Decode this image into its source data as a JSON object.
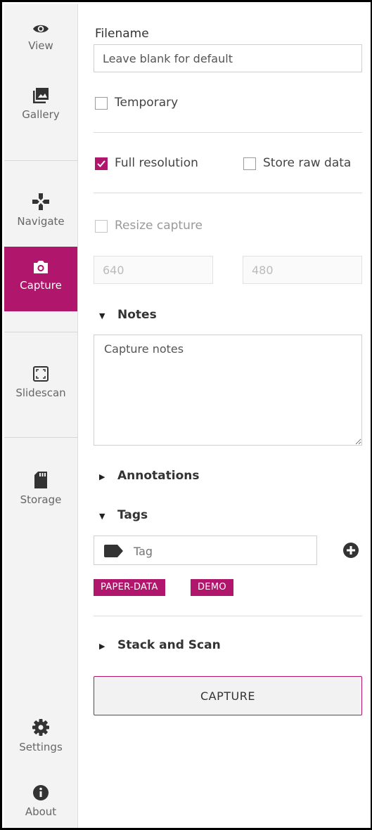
{
  "sidebar": {
    "items": [
      {
        "label": "View",
        "icon": "eye-icon"
      },
      {
        "label": "Gallery",
        "icon": "gallery-icon"
      },
      {
        "label": "Navigate",
        "icon": "navigate-icon"
      },
      {
        "label": "Capture",
        "icon": "camera-icon",
        "active": true
      },
      {
        "label": "Slidescan",
        "icon": "slidescan-icon"
      },
      {
        "label": "Storage",
        "icon": "sd-card-icon"
      }
    ],
    "bottom_items": [
      {
        "label": "Settings",
        "icon": "gear-icon"
      },
      {
        "label": "About",
        "icon": "info-icon"
      }
    ]
  },
  "capture_form": {
    "filename_label": "Filename",
    "filename_placeholder": "Leave blank for default",
    "temporary_label": "Temporary",
    "temporary_checked": false,
    "full_resolution_label": "Full resolution",
    "full_resolution_checked": true,
    "store_raw_label": "Store raw data",
    "store_raw_checked": false,
    "resize_label": "Resize capture",
    "resize_checked": false,
    "resize_width_placeholder": "640",
    "resize_height_placeholder": "480",
    "notes_section": "Notes",
    "notes_expanded": true,
    "notes_placeholder": "Capture notes",
    "annotations_section": "Annotations",
    "annotations_expanded": false,
    "tags_section": "Tags",
    "tags_expanded": true,
    "tag_input_placeholder": "Tag",
    "tags": [
      "PAPER-DATA",
      "DEMO"
    ],
    "stack_section": "Stack and Scan",
    "stack_expanded": false,
    "capture_button": "CAPTURE"
  },
  "colors": {
    "accent": "#b0166b",
    "sidebar_bg": "#f3f3f3"
  }
}
